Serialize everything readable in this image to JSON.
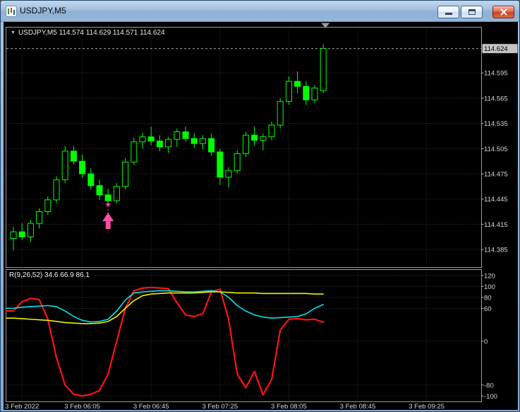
{
  "window": {
    "title": "USDJPY,M5"
  },
  "main_chart": {
    "info": {
      "collapse_icon": "▼",
      "text": "USDJPY,M5 114.574 114.629 114.571 114.624"
    },
    "price_scale": {
      "bid": "114.624",
      "labels": [
        "114.595",
        "114.565",
        "114.535",
        "114.505",
        "114.475",
        "114.445",
        "114.415",
        "114.385"
      ]
    }
  },
  "indicator": {
    "label": "R(9,26,52) 34.6 66.9 86.1",
    "scale_labels": [
      "120",
      "100",
      "80",
      "60",
      "0",
      "-80",
      "-100"
    ]
  },
  "time_axis": {
    "labels": [
      "3 Feb 2022",
      "3 Feb 06:05",
      "3 Feb 06:45",
      "3 Feb 07:25",
      "3 Feb 08:05",
      "3 Feb 08:45",
      "3 Feb 09:25"
    ]
  },
  "chart_data": [
    {
      "type": "candlestick",
      "symbol": "USDJPY",
      "timeframe": "M5",
      "ohlc_display": {
        "open": 114.574,
        "high": 114.629,
        "low": 114.571,
        "close": 114.624
      },
      "bid": 114.624,
      "y_axis": {
        "range": [
          114.364,
          114.649
        ],
        "ticks": [
          114.595,
          114.565,
          114.535,
          114.505,
          114.475,
          114.445,
          114.415,
          114.385
        ]
      },
      "colors": {
        "candle": "#00ff00",
        "background": "#000000",
        "grid": "#343434",
        "bid_label_bg": "#c4c4c4",
        "bid_line": "#b0b0b0"
      },
      "marker": {
        "type": "buy-arrow-with-star",
        "candle_index": 11,
        "price": 114.438,
        "color": "#ff4da6",
        "star_glyph": "★"
      },
      "candles": [
        [
          "05:25",
          114.398,
          114.412,
          114.384,
          114.406
        ],
        [
          "05:30",
          114.406,
          114.416,
          114.396,
          114.4
        ],
        [
          "05:35",
          114.4,
          114.42,
          114.394,
          114.416
        ],
        [
          "05:40",
          114.416,
          114.434,
          114.41,
          114.43
        ],
        [
          "05:45",
          114.43,
          114.448,
          114.426,
          114.444
        ],
        [
          "05:50",
          114.444,
          114.472,
          114.44,
          114.468
        ],
        [
          "05:55",
          114.468,
          114.508,
          114.464,
          114.502
        ],
        [
          "06:00",
          114.502,
          114.508,
          114.486,
          114.49
        ],
        [
          "06:05",
          114.49,
          114.498,
          114.47,
          114.475
        ],
        [
          "06:10",
          114.475,
          114.482,
          114.456,
          114.461
        ],
        [
          "06:15",
          114.461,
          114.468,
          114.444,
          114.45
        ],
        [
          "06:20",
          114.45,
          114.457,
          114.438,
          114.443
        ],
        [
          "06:25",
          114.443,
          114.464,
          114.44,
          114.46
        ],
        [
          "06:30",
          114.46,
          114.494,
          114.456,
          114.489
        ],
        [
          "06:35",
          114.489,
          114.518,
          114.485,
          114.513
        ],
        [
          "06:40",
          114.513,
          114.524,
          114.505,
          114.519
        ],
        [
          "06:45",
          114.519,
          114.531,
          114.509,
          114.514
        ],
        [
          "06:50",
          114.514,
          114.521,
          114.502,
          114.507
        ],
        [
          "06:55",
          114.507,
          114.519,
          114.5,
          114.516
        ],
        [
          "07:00",
          114.516,
          114.529,
          114.507,
          114.525
        ],
        [
          "07:05",
          114.525,
          114.531,
          114.513,
          114.517
        ],
        [
          "07:10",
          114.517,
          114.523,
          114.506,
          114.511
        ],
        [
          "07:15",
          114.511,
          114.521,
          114.504,
          114.517
        ],
        [
          "07:20",
          114.517,
          114.523,
          114.496,
          114.501
        ],
        [
          "07:25",
          114.501,
          114.505,
          114.462,
          114.471
        ],
        [
          "07:30",
          114.471,
          114.483,
          114.459,
          114.479
        ],
        [
          "07:35",
          114.479,
          114.503,
          114.475,
          114.499
        ],
        [
          "07:40",
          114.499,
          114.525,
          114.495,
          114.521
        ],
        [
          "07:45",
          114.521,
          114.531,
          114.509,
          114.515
        ],
        [
          "07:50",
          114.515,
          114.523,
          114.503,
          114.519
        ],
        [
          "07:55",
          114.519,
          114.537,
          114.515,
          114.533
        ],
        [
          "08:00",
          114.533,
          114.565,
          114.529,
          114.561
        ],
        [
          "08:05",
          114.561,
          114.591,
          114.557,
          114.585
        ],
        [
          "08:10",
          114.585,
          114.597,
          114.571,
          114.579
        ],
        [
          "08:15",
          114.579,
          114.585,
          114.557,
          114.563
        ],
        [
          "08:20",
          114.563,
          114.581,
          114.559,
          114.577
        ],
        [
          "08:25",
          114.574,
          114.629,
          114.571,
          114.624
        ]
      ]
    },
    {
      "type": "line",
      "name": "R(9,26,52)",
      "display_values": [
        34.6,
        66.9,
        86.1
      ],
      "range": [
        -110,
        130
      ],
      "y_ticks": [
        120,
        100,
        80,
        60,
        0,
        -80,
        -100
      ],
      "series": [
        {
          "name": "signal-red",
          "color": "#ff1212",
          "width": 2.2,
          "values": [
            55,
            72,
            78,
            76,
            40,
            -30,
            -80,
            -97,
            -100,
            -97,
            -90,
            -60,
            0,
            60,
            92,
            97,
            98,
            97,
            96,
            70,
            48,
            45,
            50,
            90,
            95,
            40,
            -60,
            -85,
            -55,
            -98,
            -70,
            20,
            40,
            41,
            39,
            40,
            34.6
          ]
        },
        {
          "name": "signal-aqua",
          "color": "#00e8e8",
          "width": 1.6,
          "values": [
            60,
            62,
            63,
            64,
            65,
            63,
            55,
            45,
            38,
            35,
            36,
            40,
            55,
            75,
            88,
            90,
            91,
            92,
            92,
            91,
            90,
            90,
            91,
            92,
            90,
            80,
            65,
            55,
            48,
            44,
            42,
            43,
            44,
            45,
            50,
            60,
            66.9
          ]
        },
        {
          "name": "signal-yellow",
          "color": "#f0f000",
          "width": 1.6,
          "values": [
            42,
            41,
            40,
            39,
            38,
            36,
            34,
            33,
            32,
            32,
            33,
            36,
            45,
            60,
            74,
            83,
            86,
            87,
            88,
            88,
            88,
            88,
            89,
            90,
            90,
            89,
            88,
            88,
            88,
            87,
            87,
            87,
            87,
            87,
            87,
            86,
            86.1
          ]
        }
      ]
    }
  ]
}
